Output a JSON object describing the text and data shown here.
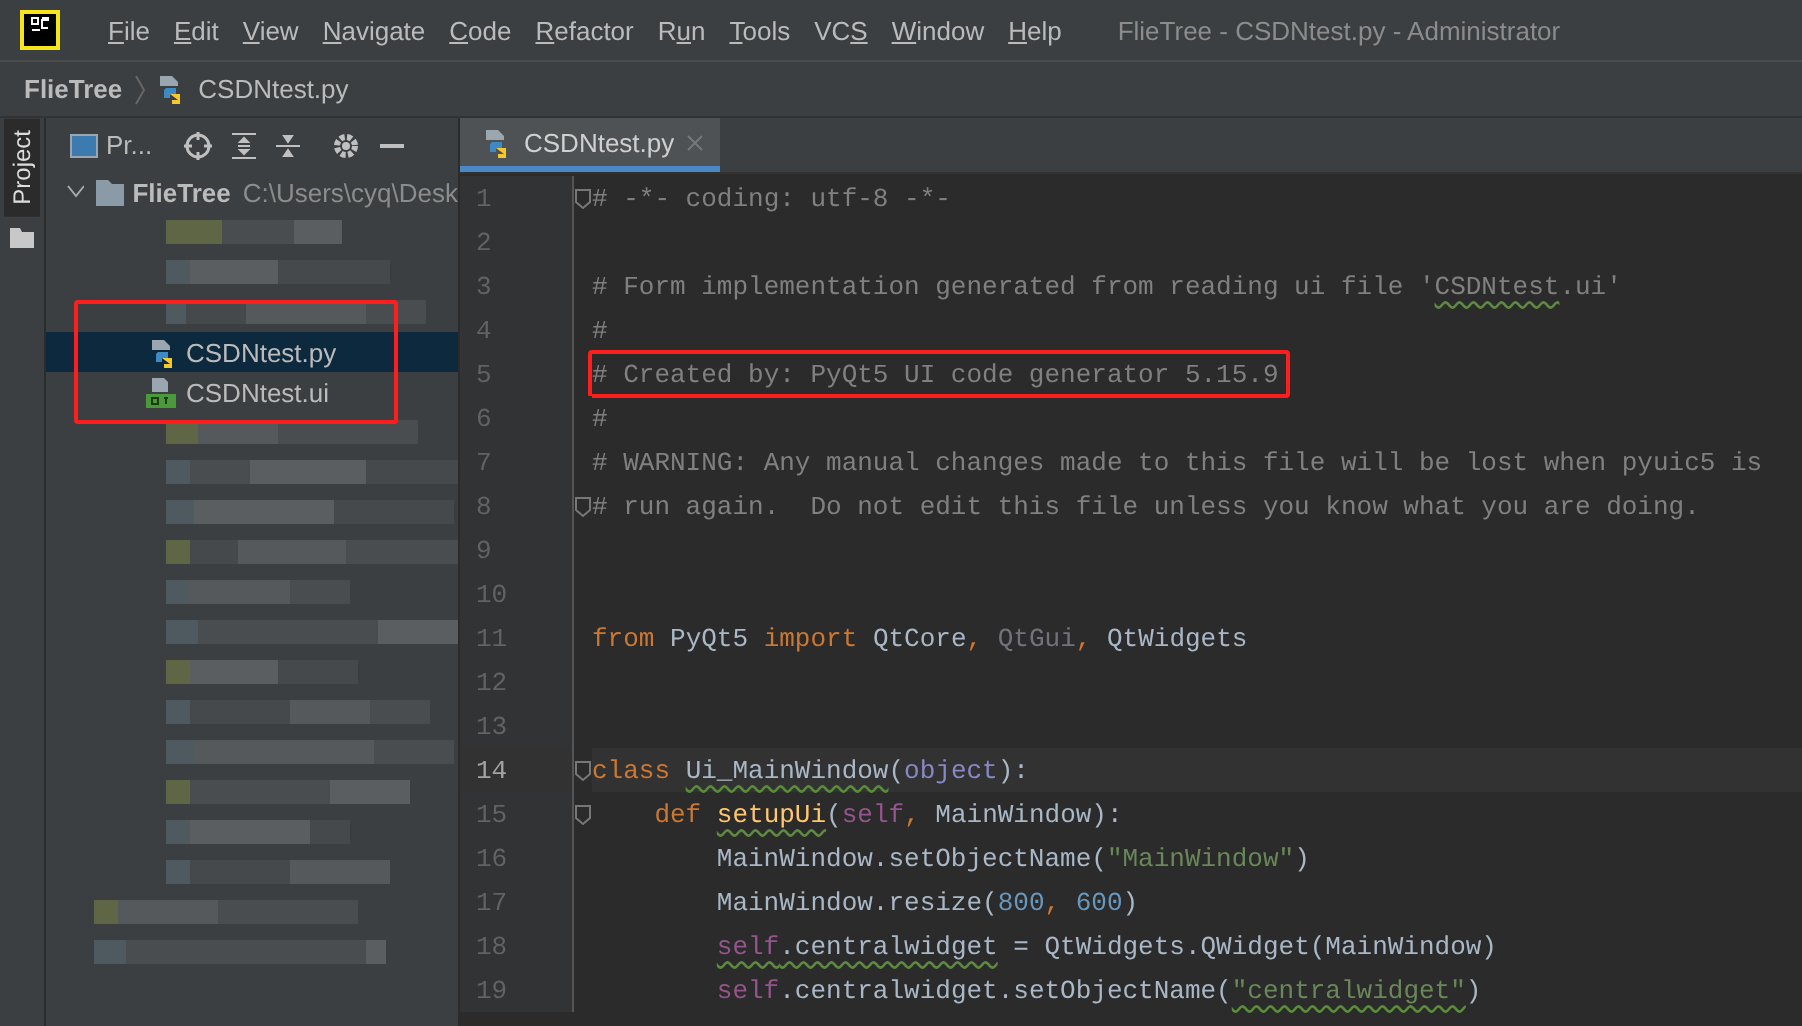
{
  "menu": [
    {
      "key": "F",
      "post": "ile"
    },
    {
      "key": "E",
      "post": "dit"
    },
    {
      "key": "V",
      "post": "iew"
    },
    {
      "key": "N",
      "post": "avigate"
    },
    {
      "key": "C",
      "post": "ode"
    },
    {
      "key": "R",
      "post": "efactor"
    },
    {
      "pre": "R",
      "key": "u",
      "post": "n"
    },
    {
      "key": "T",
      "post": "ools"
    },
    {
      "pre": "VC",
      "key": "S"
    },
    {
      "key": "W",
      "post": "indow"
    },
    {
      "key": "H",
      "post": "elp"
    }
  ],
  "window_title": "FlieTree - CSDNtest.py - Administrator",
  "breadcrumb": [
    "FlieTree",
    "CSDNtest.py"
  ],
  "side_stripe": {
    "label": "Project",
    "selected": true
  },
  "project_panel": {
    "title": "Pr...",
    "root": {
      "name": "FlieTree",
      "path": "C:\\Users\\cyq\\Desk",
      "expanded": true,
      "children_highlighted": true,
      "children": [
        {
          "name": "CSDNtest.py",
          "kind": "python",
          "selected": true
        },
        {
          "name": "CSDNtest.ui",
          "kind": "qt",
          "selected": false
        }
      ]
    }
  },
  "editor": {
    "tabs": [
      {
        "label": "CSDNtest.py",
        "selected": true
      }
    ],
    "lines": [
      {
        "n": "1",
        "current": false,
        "highlighted": false,
        "fold": true,
        "tokens": [
          {
            "kind": "comment",
            "text": "# -*- coding: utf-8 -*-"
          }
        ]
      },
      {
        "n": "2",
        "current": false,
        "fold": false
      },
      {
        "n": "3",
        "current": false,
        "highlighted": false,
        "fold": false,
        "tokens": [
          {
            "kind": "comment",
            "text": "# Form implementation generated from reading ui file '"
          },
          {
            "kind": "comment",
            "text": "CSDNtest",
            "typo": true
          },
          {
            "kind": "comment",
            "text": ".ui'"
          }
        ]
      },
      {
        "n": "4",
        "current": false,
        "highlighted": false,
        "fold": false,
        "tokens": [
          {
            "kind": "comment",
            "text": "#"
          }
        ]
      },
      {
        "n": "5",
        "current": false,
        "highlighted": true,
        "fold": false,
        "tokens": [
          {
            "kind": "comment",
            "text": "# Created by: PyQt5 UI code generator 5.15.9"
          }
        ]
      },
      {
        "n": "6",
        "current": false,
        "highlighted": false,
        "fold": false,
        "tokens": [
          {
            "kind": "comment",
            "text": "#"
          }
        ]
      },
      {
        "n": "7",
        "current": false,
        "highlighted": false,
        "fold": false,
        "tokens": [
          {
            "kind": "comment",
            "text": "# WARNING: Any manual changes made to this file will be lost when pyuic5 is"
          }
        ]
      },
      {
        "n": "8",
        "current": false,
        "highlighted": false,
        "fold": true,
        "tokens": [
          {
            "kind": "comment",
            "text": "# run again.  Do not edit this file unless you know what you are doing."
          }
        ]
      },
      {
        "n": "9",
        "current": false,
        "fold": false
      },
      {
        "n": "10",
        "current": false,
        "fold": false
      },
      {
        "n": "11",
        "current": false,
        "highlighted": false,
        "fold": false,
        "tokens": [
          {
            "kind": "keyword",
            "text": "from"
          },
          {
            "kind": "plain",
            "text": " PyQt5 "
          },
          {
            "kind": "keyword",
            "text": "import"
          },
          {
            "kind": "plain",
            "text": " QtCore"
          },
          {
            "kind": "keyword",
            "text": ", "
          },
          {
            "kind": "unused",
            "text": "QtGui"
          },
          {
            "kind": "keyword",
            "text": ", "
          },
          {
            "kind": "plain",
            "text": "QtWidgets"
          }
        ]
      },
      {
        "n": "12",
        "current": false,
        "fold": false
      },
      {
        "n": "13",
        "current": false,
        "fold": false
      },
      {
        "n": "14",
        "current": true,
        "highlighted": false,
        "fold": true,
        "tokens": [
          {
            "kind": "keyword",
            "text": "class "
          },
          {
            "kind": "plain",
            "text": "Ui_MainWindow",
            "typo": true
          },
          {
            "kind": "plain",
            "text": "("
          },
          {
            "kind": "builtin",
            "text": "object"
          },
          {
            "kind": "plain",
            "text": "):"
          }
        ]
      },
      {
        "n": "15",
        "current": false,
        "highlighted": false,
        "fold": true,
        "kind": "method",
        "tokens": [
          {
            "kind": "keyword",
            "text": "def "
          },
          {
            "kind": "func",
            "text": "setupUi",
            "typo": true
          },
          {
            "kind": "plain",
            "text": "("
          },
          {
            "kind": "self",
            "text": "self"
          },
          {
            "kind": "keyword",
            "text": ", "
          },
          {
            "kind": "plain",
            "text": "MainWindow):"
          }
        ]
      },
      {
        "n": "16",
        "current": false,
        "highlighted": false,
        "fold": false,
        "kind": "body",
        "tokens": [
          {
            "kind": "plain",
            "text": "MainWindow.setObjectName("
          },
          {
            "kind": "string",
            "text": "\"MainWindow\""
          },
          {
            "kind": "plain",
            "text": ")"
          }
        ]
      },
      {
        "n": "17",
        "current": false,
        "highlighted": false,
        "fold": false,
        "kind": "body",
        "tokens": [
          {
            "kind": "plain",
            "text": "MainWindow.resize("
          },
          {
            "kind": "number",
            "text": "800"
          },
          {
            "kind": "keyword",
            "text": ", "
          },
          {
            "kind": "number",
            "text": "600"
          },
          {
            "kind": "plain",
            "text": ")"
          }
        ]
      },
      {
        "n": "18",
        "current": false,
        "highlighted": false,
        "fold": false,
        "kind": "body",
        "tokens": [
          {
            "kind": "self",
            "text": "self",
            "typo": true
          },
          {
            "kind": "plain",
            "text": ".centralwidget",
            "typo": true
          },
          {
            "kind": "plain",
            "text": " = QtWidgets.QWidget(MainWindow)"
          }
        ]
      },
      {
        "n": "19",
        "current": false,
        "highlighted": false,
        "fold": false,
        "kind": "body",
        "tokens": [
          {
            "kind": "self",
            "text": "self"
          },
          {
            "kind": "plain",
            "text": ".centralwidget.setObjectName("
          },
          {
            "kind": "string",
            "text": "\"centralwidget\"",
            "typo": true
          },
          {
            "kind": "plain",
            "text": ")"
          }
        ]
      }
    ]
  }
}
